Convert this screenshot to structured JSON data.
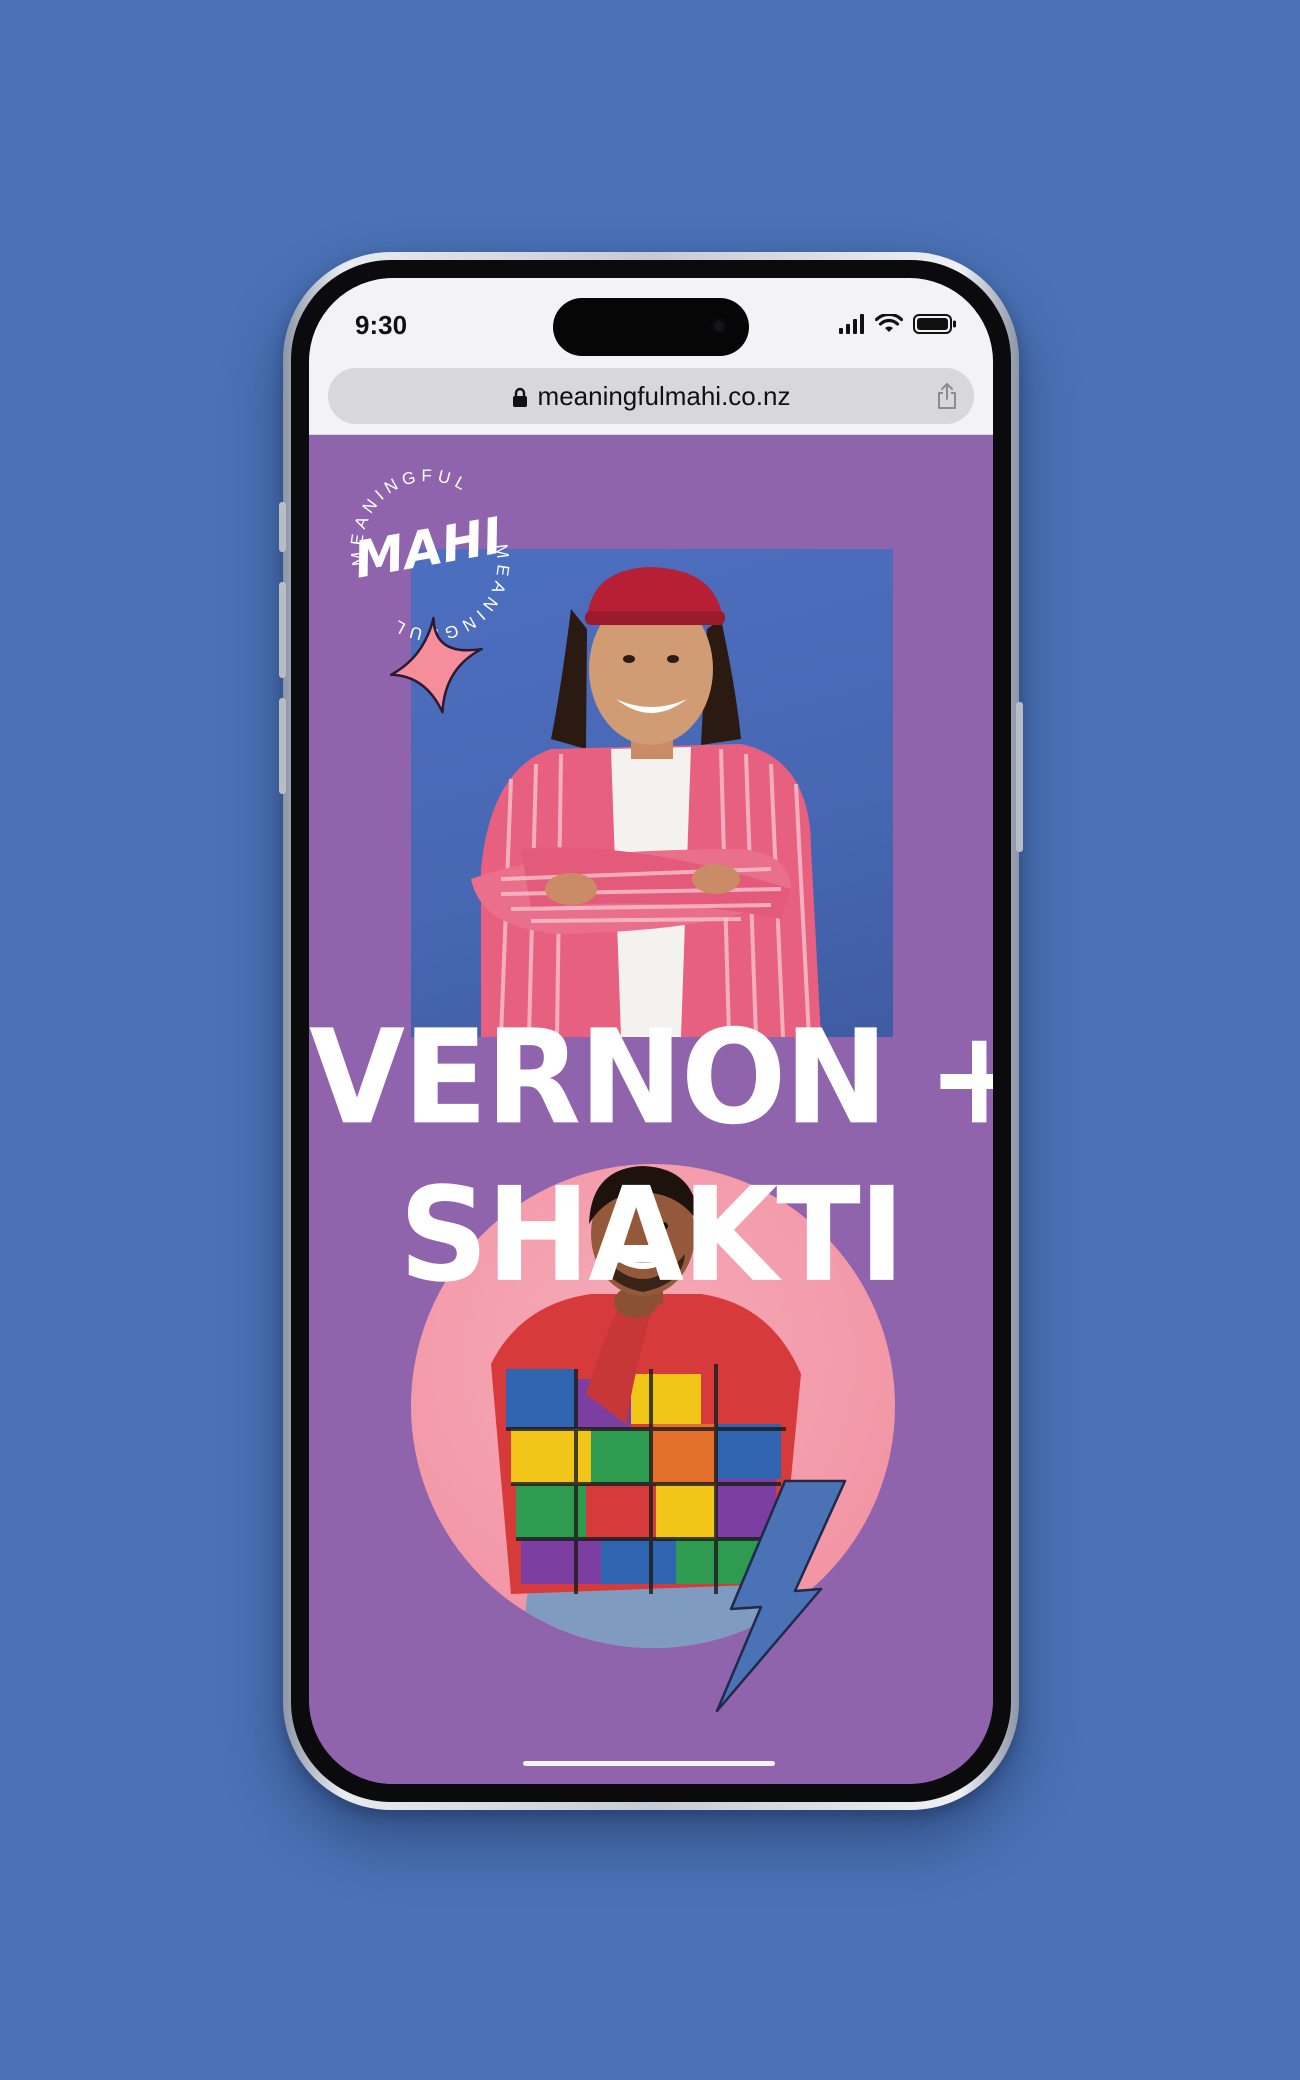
{
  "status_bar": {
    "time": "9:30"
  },
  "browser": {
    "url": "meaningfulmahi.co.nz"
  },
  "logo": {
    "ring_text": "MEANINGFUL",
    "ring_text_lower": "MEANINGFUL",
    "word": "MAHI"
  },
  "hero": {
    "line1": "VERNON +",
    "line2": "SHAKTI"
  },
  "colors": {
    "background": "#4a72b5",
    "page": "#8f64ad",
    "photo_blue": "#4a6bb8",
    "accent_pink": "#f49aaa",
    "accent_blue": "#4a72b5",
    "text_white": "#ffffff"
  },
  "icons": [
    "signal-icon",
    "wifi-icon",
    "battery-icon",
    "lock-icon",
    "share-icon",
    "sparkle-icon",
    "lightning-bolt-icon"
  ]
}
